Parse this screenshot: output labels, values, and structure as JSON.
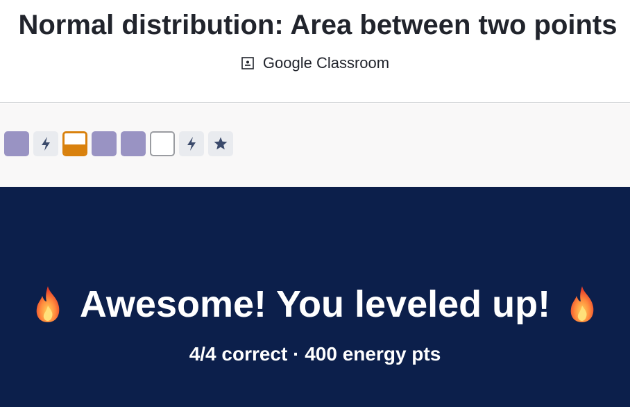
{
  "header": {
    "title": "Normal distribution: Area between two points",
    "classroom_label": "Google Classroom",
    "classroom_icon": "google-classroom-icon"
  },
  "skills": [
    {
      "state": "filled"
    },
    {
      "state": "bolt",
      "icon": "lightning-icon"
    },
    {
      "state": "half"
    },
    {
      "state": "filled"
    },
    {
      "state": "filled"
    },
    {
      "state": "empty"
    },
    {
      "state": "bolt",
      "icon": "lightning-icon"
    },
    {
      "state": "star",
      "icon": "star-icon"
    }
  ],
  "banner": {
    "title": "Awesome! You leveled up!",
    "summary": "4/4 correct · 400 energy pts",
    "icon": "flame-icon"
  },
  "colors": {
    "banner_bg": "#0c1f4b",
    "skill_filled": "#9993c3",
    "skill_half": "#d9810d",
    "icon_dark": "#3b4a6b"
  }
}
